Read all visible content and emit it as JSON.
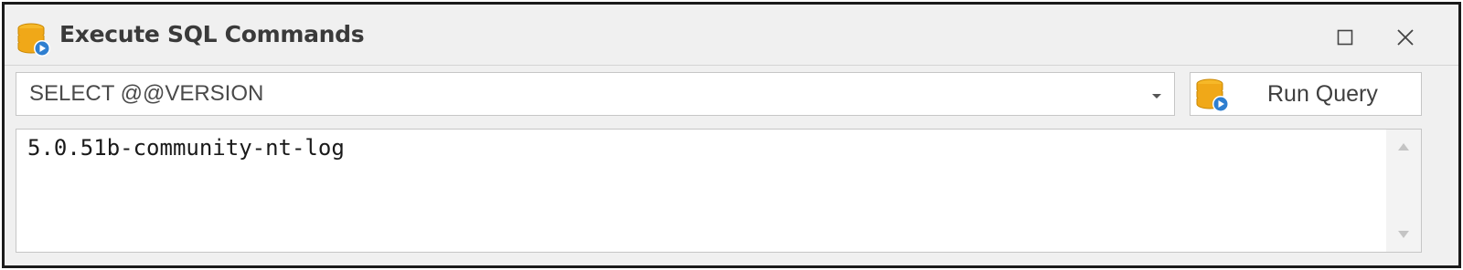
{
  "window": {
    "title": "Execute SQL Commands",
    "icon": "database-run-icon",
    "controls": [
      "maximize-icon",
      "close-icon"
    ]
  },
  "query": {
    "value": "SELECT @@VERSION",
    "dropdown_icon": "chevron-down-icon"
  },
  "run_button": {
    "label": "Run Query",
    "icon": "database-run-icon"
  },
  "result": {
    "text": "5.0.51b-community-nt-log"
  },
  "colors": {
    "db_gold": "#f0a818",
    "db_gold_dark": "#c88600",
    "play_blue": "#2f7fd0",
    "frame": "#f0f0f0",
    "border": "#c6c6c6"
  }
}
